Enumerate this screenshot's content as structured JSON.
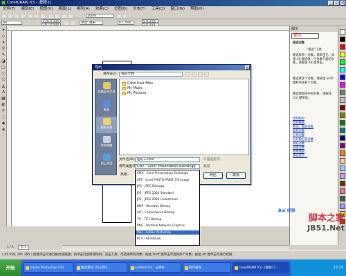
{
  "window": {
    "title": "CorelDRAW X3 - [图形1]"
  },
  "menubar": {
    "items": [
      "文件(F)",
      "编辑(E)",
      "视图(V)",
      "版面(L)",
      "排列(A)",
      "效果(C)",
      "位图(B)",
      "文本(T)",
      "工具(O)",
      "窗口(W)",
      "帮助(H)"
    ]
  },
  "toolbar": {
    "zoom": "100%",
    "paper": "A4",
    "width": "210.0 mm",
    "height": "297.0 mm",
    "units": "单位: 毫米",
    "nudge": "0.1 mm",
    "dup_x": "5.0 mm",
    "dup_y": "5.0 mm"
  },
  "page_tabs": {
    "label": "1 / 1",
    "page": "页 1"
  },
  "docker": {
    "title": "提示",
    "heading": "提示",
    "subheading": "挑选对象",
    "tool_name": "“挑选”工具",
    "lines": [
      "要选择单一对象，请单击它。如果 Alt 键选择一个对象下面的对象，请按住 Alt 键单击。",
      "要选择多个对象，请按住 Shift 键并单击各个对象。",
      "要选择群组中的对象，请按住 Ctrl 键单击。"
    ],
    "links": [
      "绘制矩形",
      "绘制椭圆",
      "移动、缩放对象",
      "复制对象",
      "分布对象",
      "对齐和分布对象",
      "填充对象",
      "轮廓对象",
      "使用图层",
      "更多提示..."
    ]
  },
  "palette": {
    "colors": [
      "#ffffff",
      "#000000",
      "#ff0000",
      "#ffff00",
      "#00ff00",
      "#00ffff",
      "#0000ff",
      "#ff00ff",
      "#808080",
      "#c0c0c0",
      "#800000",
      "#808000",
      "#008000",
      "#008080",
      "#000080",
      "#800080",
      "#ff8000",
      "#ffcc99",
      "#99ccff",
      "#cc99ff",
      "#663300",
      "#ff6699",
      "#336633",
      "#9999ff",
      "#ffcc00",
      "#cc3300"
    ]
  },
  "dialog": {
    "title": "导出",
    "look_in_label": "保存在(I):",
    "look_in_value": "我的文档",
    "places": [
      "我最近的文档",
      "桌面",
      "我的文档",
      "我的电脑",
      "网上邻居"
    ],
    "files": [
      "Corel User Files",
      "My Music",
      "My Pictures"
    ],
    "filename_label": "文件名(N):",
    "filename_value": "图形1.cmx",
    "filetype_label": "保存类型(T):",
    "filetype_value": "CMX - Corel Presentation Exchange",
    "export_button": "导出",
    "cancel_button": "取消",
    "advanced_button": "高级...",
    "compat_label": "兼容",
    "selected_only": "只是选定的",
    "file_types": [
      "CMX - Corel Presentation Exchange",
      "CPT - Corel PHOTO-PAINT 7/8 Image",
      "JPG - JPEG Bitmaps",
      "JP2 - JPEG 2000 Standard",
      "JP2 - JPEG 2000 Codestream",
      "BMP - Windows Bitmap",
      "GIF - CompuServe Bitmap",
      "TIF - TIFF Bitmap",
      "PNG - Portable Network Graphics",
      "PSD - Adobe Photoshop",
      "PCX - PaintBrush"
    ],
    "selected_type_index": 9
  },
  "status": {
    "text": "( 41.558, 201.285 )   接着单击可进行拖动或缩放；再单击可旋转或倾斜；双击工具，可选择所有对象；按住 Shift 键单击可选择多个对象；按住 Alt 键单击可进行挖掘"
  },
  "taskbar": {
    "start": "开始",
    "tasks": [
      "Adobe Photoshop CS5",
      "精选素材_可以用作...",
      "untitled.txt - 记事本",
      "制作教程",
      "CorelDRAW X3 - [图形1]"
    ],
    "active_index": 4,
    "clock": "23:19"
  },
  "watermark": {
    "text": "脚本之家",
    "url": "JB51.Net",
    "baidu": "Bai 经验"
  }
}
